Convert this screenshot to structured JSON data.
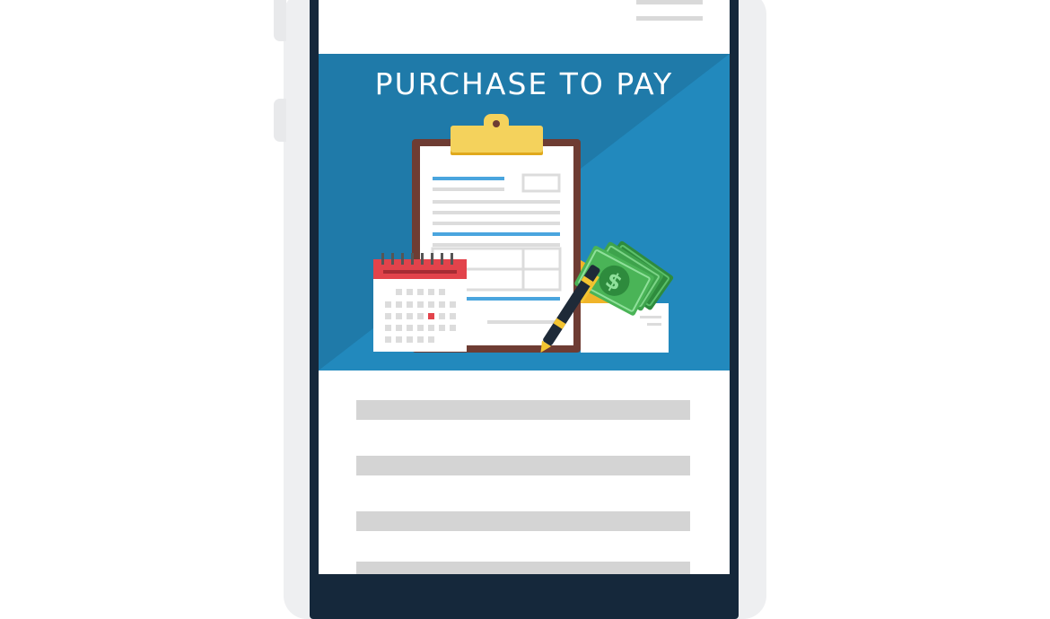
{
  "banner": {
    "title": "PURCHASE TO PAY",
    "background_color": "#2483b6",
    "shade_color": "#1f7aa9"
  },
  "illustration": {
    "icons": [
      "clipboard-icon",
      "calendar-icon",
      "pen-icon",
      "cash-icon",
      "envelope-icon",
      "coin-icon"
    ],
    "cash_symbol": "$"
  },
  "colors": {
    "bezel": "#15283b",
    "shell": "#eeeff1",
    "placeholder": "#d4d4d4"
  }
}
